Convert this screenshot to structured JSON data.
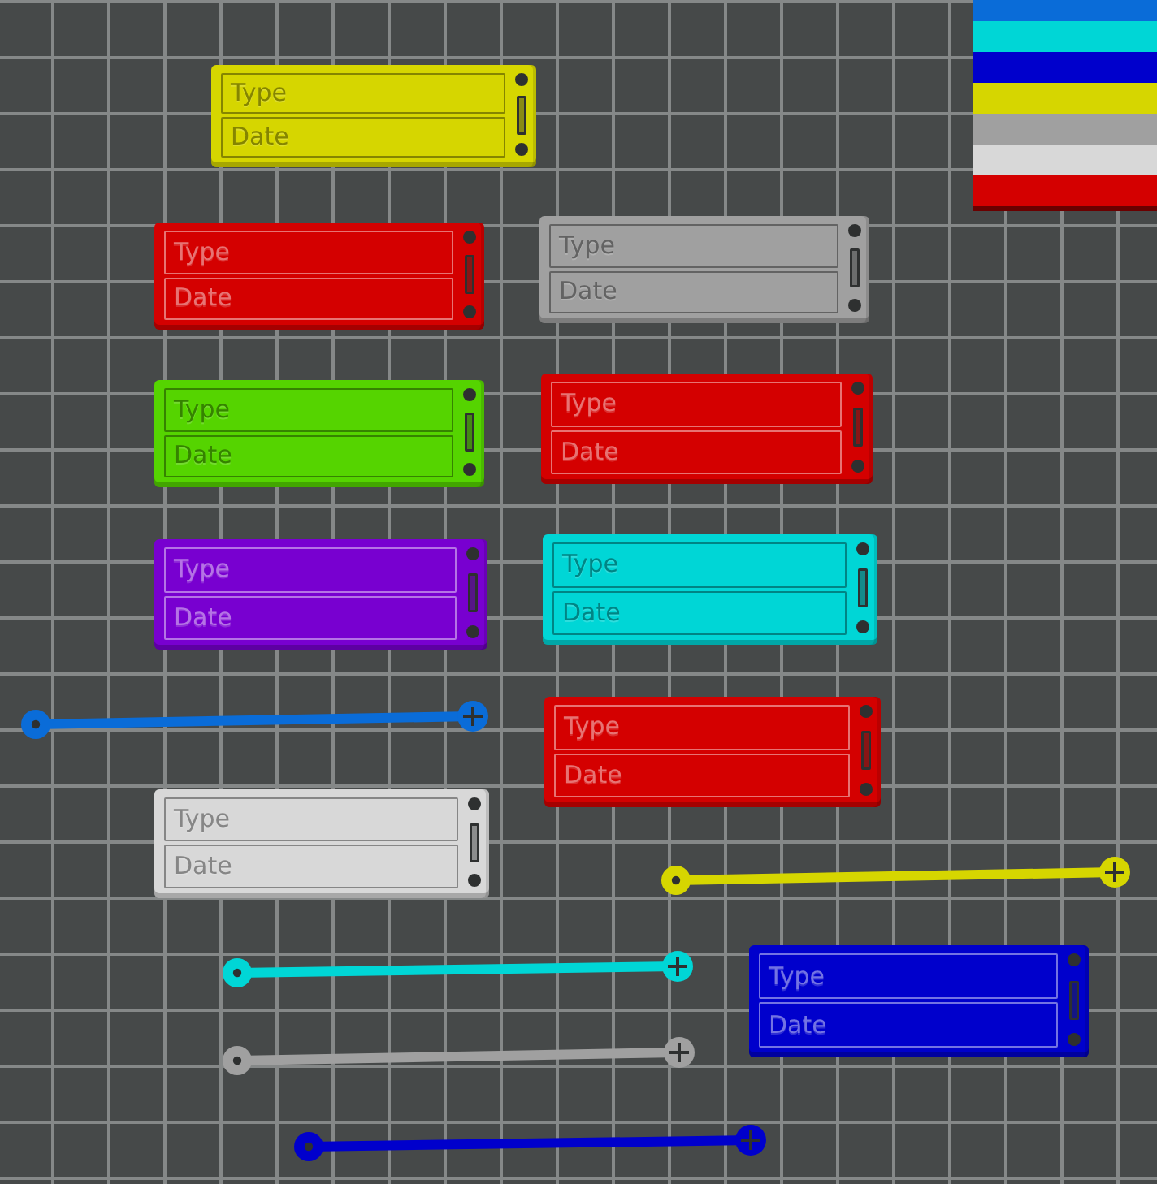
{
  "plate": {
    "tags": [
      {
        "color": "#d6d600",
        "fields": [
          "Type",
          "Date"
        ]
      },
      {
        "color": "#d40000",
        "fields": [
          "Type",
          "Date"
        ]
      },
      {
        "color": "#a0a0a0",
        "fields": [
          "Type",
          "Date"
        ]
      },
      {
        "color": "#55d400",
        "fields": [
          "Type",
          "Date"
        ]
      },
      {
        "color": "#d40000",
        "fields": [
          "Type",
          "Date"
        ]
      },
      {
        "color": "#7800d0",
        "fields": [
          "Type",
          "Date"
        ]
      },
      {
        "color": "#00d6d6",
        "fields": [
          "Type",
          "Date"
        ]
      },
      {
        "color": "#d40000",
        "fields": [
          "Type",
          "Date"
        ]
      },
      {
        "color": "#d8d8d8",
        "fields": [
          "Type",
          "Date"
        ]
      },
      {
        "color": "#0000cc",
        "fields": [
          "Type",
          "Date"
        ]
      }
    ],
    "rods": [
      {
        "color": "#0a6cd8"
      },
      {
        "color": "#d6d600"
      },
      {
        "color": "#00d6d6"
      },
      {
        "color": "#a0a0a0"
      },
      {
        "color": "#0000cc"
      }
    ],
    "swatches": [
      {
        "color": "#0a6cd8"
      },
      {
        "color": "#00d6d6"
      },
      {
        "color": "#0000cc"
      },
      {
        "color": "#d6d600"
      },
      {
        "color": "#a0a0a0"
      },
      {
        "color": "#d8d8d8"
      },
      {
        "color": "#d40000"
      }
    ]
  }
}
